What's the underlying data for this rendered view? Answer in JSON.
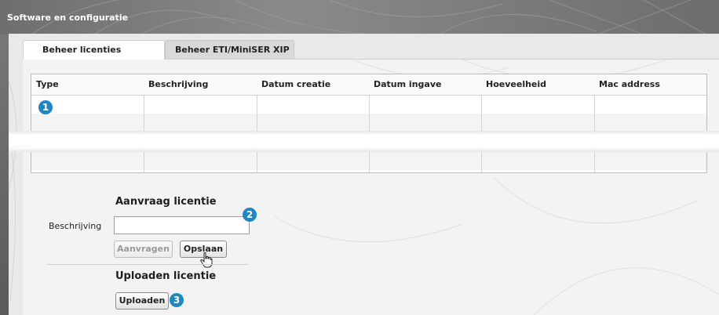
{
  "window": {
    "title": "Software en configuratie"
  },
  "tabs": [
    {
      "label": "Beheer licenties",
      "active": true
    },
    {
      "label": "Beheer ETI/MiniSER XIP",
      "active": false
    }
  ],
  "licenses_table": {
    "columns": [
      "Type",
      "Beschrijving",
      "Datum creatie",
      "Datum ingave",
      "Hoeveelheid",
      "Mac address"
    ],
    "rows": []
  },
  "request_license": {
    "title": "Aanvraag licentie",
    "description_label": "Beschrijving",
    "description_value": "",
    "request_button": "Aanvragen",
    "save_button": "Opslaan"
  },
  "upload_license": {
    "title": "Uploaden licentie",
    "upload_button": "Uploaden"
  },
  "callouts": [
    "1",
    "2",
    "3"
  ],
  "colors": {
    "callout": "#1f86c4",
    "title_bar": "#7a7a7a",
    "panel": "#e9e9e9"
  }
}
